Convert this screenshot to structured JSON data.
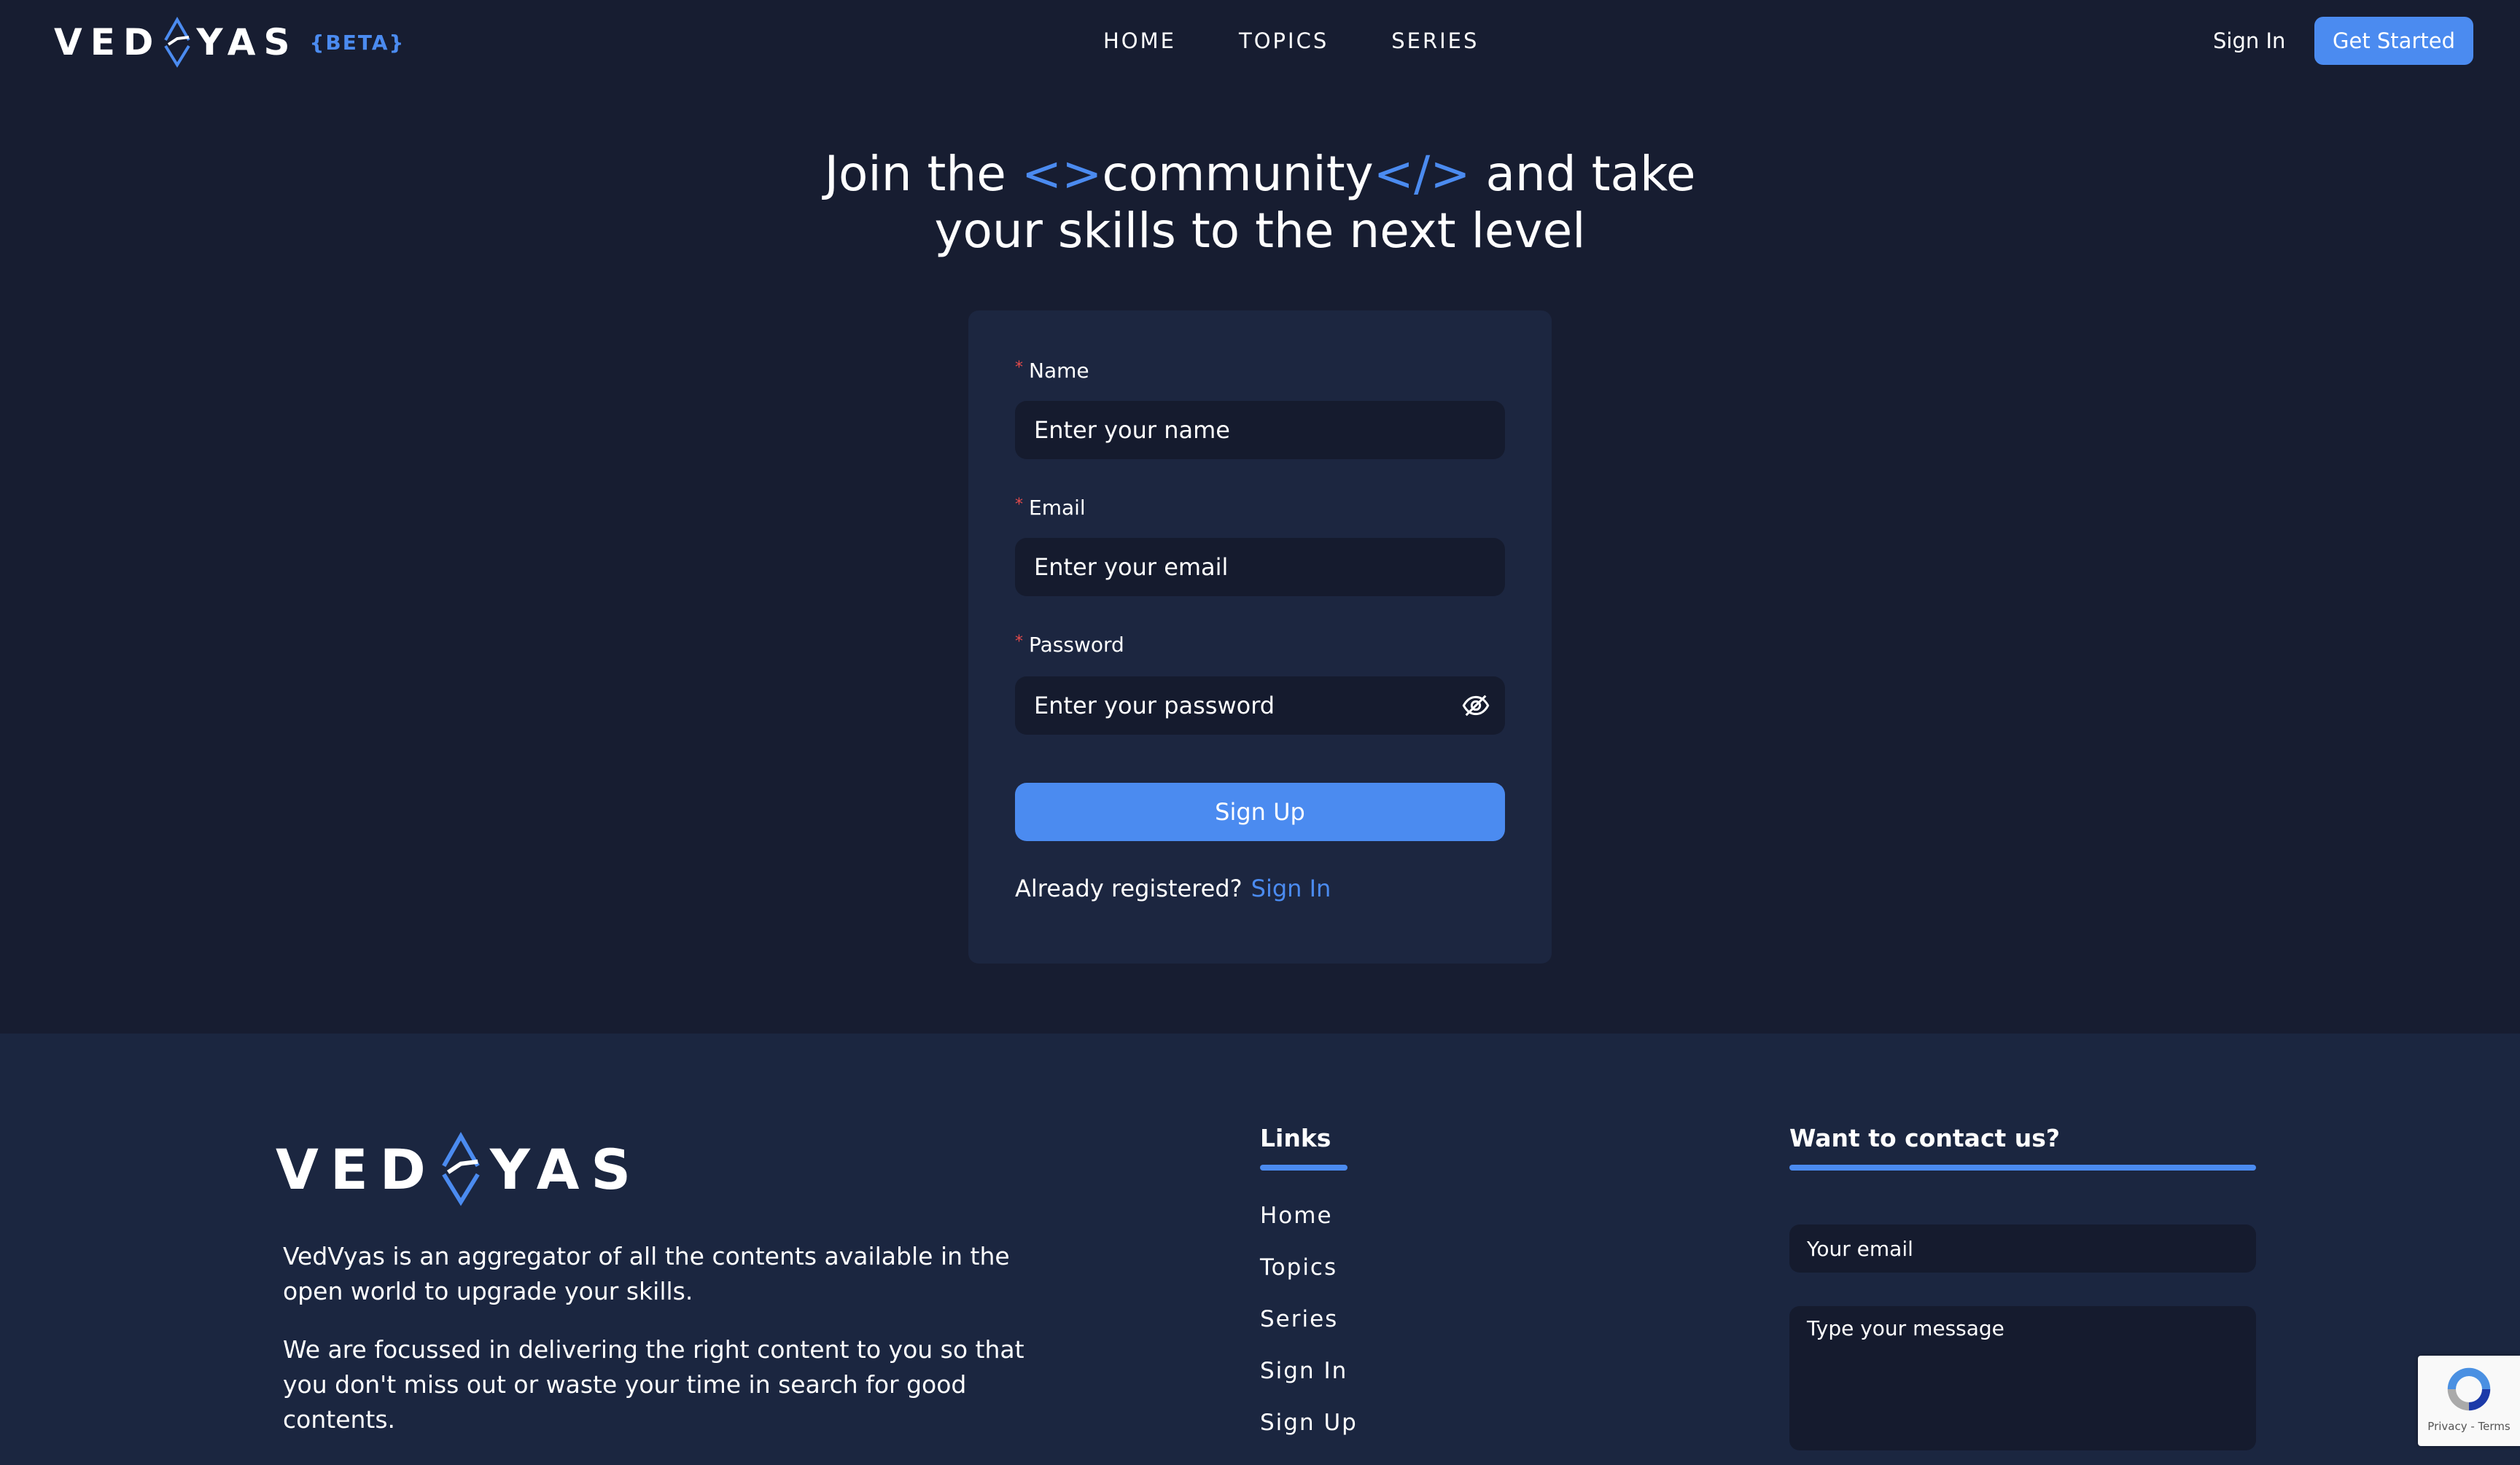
{
  "header": {
    "logo_left": "VED",
    "logo_right": "YAS",
    "beta": "{BETA}",
    "nav": [
      "HOME",
      "TOPICS",
      "SERIES"
    ],
    "sign_in": "Sign In",
    "get_started": "Get Started"
  },
  "hero": {
    "part1": "Join the ",
    "code_open": "<>",
    "word": "community",
    "code_close": "</>",
    "part2": " and take",
    "line2": "your skills to the next level"
  },
  "form": {
    "name_label": "Name",
    "name_placeholder": "Enter your name",
    "email_label": "Email",
    "email_placeholder": "Enter your email",
    "password_label": "Password",
    "password_placeholder": "Enter your password",
    "submit": "Sign Up",
    "registered_text": "Already registered?",
    "sign_in_link": "Sign In"
  },
  "footer": {
    "logo_left": "VED",
    "logo_right": "YAS",
    "about_1": "VedVyas is an aggregator of all the contents available in the open world to upgrade your skills.",
    "about_2": "We are focussed in delivering the right content to you so that you don't miss out or waste your time in search for good contents.",
    "links_title": "Links",
    "links": [
      "Home",
      "Topics",
      "Series",
      "Sign In",
      "Sign Up"
    ],
    "contact_title": "Want to contact us?",
    "contact_email_placeholder": "Your email",
    "contact_message_placeholder": "Type your message"
  },
  "recaptcha": {
    "text": "Privacy - Terms"
  },
  "colors": {
    "background": "#171d31",
    "card": "#1c2640",
    "footer": "#1b2640",
    "input": "#151b2e",
    "accent": "#4b8bf0",
    "required": "#e54b4b"
  }
}
